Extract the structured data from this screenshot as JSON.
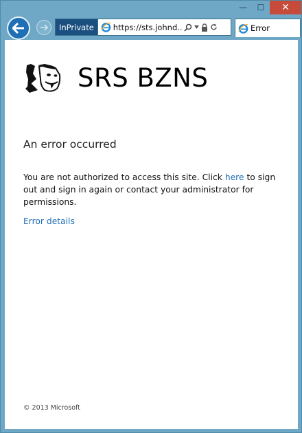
{
  "window": {
    "caption": {
      "minimize": "—",
      "maximize": "☐",
      "close": "✕"
    }
  },
  "toolbar": {
    "inprivate_label": "InPrivate",
    "url": "https://sts.johnd...",
    "tab_title": "Error"
  },
  "page": {
    "brand": "SRS BZNS",
    "heading": "An error occurred",
    "message_pre": "You are not authorized to access this site. Click ",
    "message_link": "here",
    "message_post": " to sign out and sign in again or contact your administrator for permissions.",
    "details_link": "Error details",
    "footer": "© 2013 Microsoft"
  },
  "colors": {
    "frame": "#6ea8c6",
    "link": "#1e6fb5",
    "close_button": "#c74b3a",
    "inprivate_badge": "#1b4f80"
  },
  "icons": [
    "back-arrow-icon",
    "forward-arrow-icon",
    "ie-logo-icon",
    "search-icon",
    "dropdown-icon",
    "lock-icon",
    "refresh-icon",
    "meme-face-icon"
  ]
}
